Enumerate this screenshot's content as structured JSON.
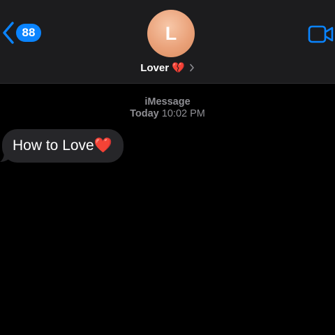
{
  "header": {
    "back_count": "88",
    "avatar_initial": "L",
    "contact_name": "Lover",
    "contact_emoji": "💔"
  },
  "thread": {
    "service": "iMessage",
    "day": "Today",
    "time": "10:02 PM"
  },
  "messages": [
    {
      "direction": "incoming",
      "text": "How to Love",
      "emoji": "❤️"
    }
  ],
  "colors": {
    "accent": "#0a84ff",
    "header_bg": "#1c1c1e",
    "bubble_incoming": "#262629",
    "avatar": "#eaa27a",
    "meta_text": "#8e8e93"
  },
  "icons": {
    "back": "chevron-left-icon",
    "info": "chevron-right-icon",
    "video": "video-camera-icon"
  }
}
